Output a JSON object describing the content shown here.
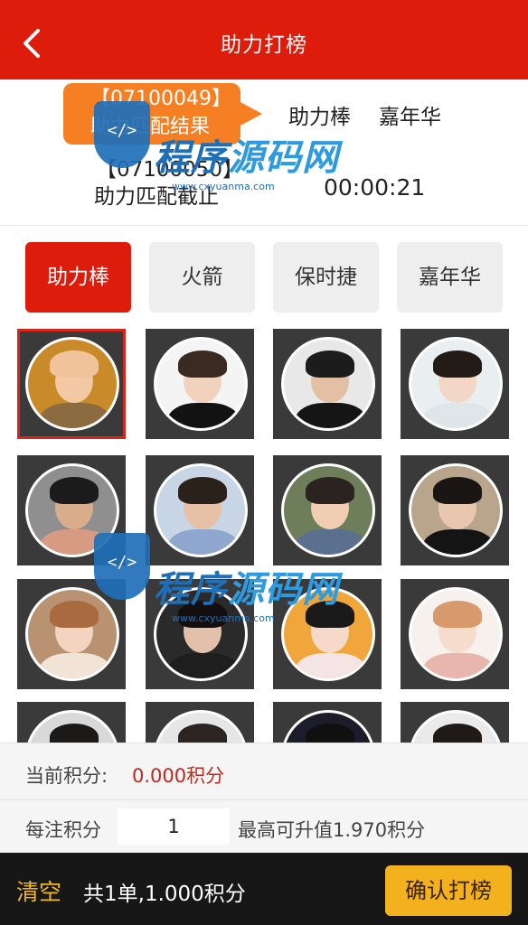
{
  "header": {
    "title": "助力打榜",
    "back_icon": "chevron-left-icon"
  },
  "info": {
    "bubble_line1": "【07100049】",
    "bubble_line2": "助力匹配结果",
    "prize_a": "助力棒",
    "prize_b": "嘉年华",
    "deadline_id": "【07100050】",
    "deadline_label": "助力匹配截止",
    "countdown": "00:00:21"
  },
  "tabs": [
    {
      "label": "助力棒",
      "active": true
    },
    {
      "label": "火箭",
      "active": false
    },
    {
      "label": "保时捷",
      "active": false
    },
    {
      "label": "嘉年华",
      "active": false
    }
  ],
  "avatars": [
    {
      "bg": "#c98a2a",
      "skin": "#f3c9a4",
      "hair": "#f1c39b",
      "cloth": "#8b6b3f",
      "selected": true
    },
    {
      "bg": "#f4f4f4",
      "skin": "#f1d2bd",
      "hair": "#3a2a22",
      "cloth": "#121212",
      "selected": false
    },
    {
      "bg": "#e8e8e8",
      "skin": "#e3bfa4",
      "hair": "#1c1c1c",
      "cloth": "#151515",
      "selected": false
    },
    {
      "bg": "#e9eef1",
      "skin": "#f2d7c6",
      "hair": "#231b16",
      "cloth": "#dfe6ea",
      "selected": false
    },
    {
      "bg": "#8f8f8f",
      "skin": "#d7ad8c",
      "hair": "#1b1b1b",
      "cloth": "#d79a83",
      "selected": false
    },
    {
      "bg": "#c7d5e4",
      "skin": "#e6c1a5",
      "hair": "#2a211b",
      "cloth": "#8fa7cf",
      "selected": false
    },
    {
      "bg": "#6f7e5a",
      "skin": "#f0cdb3",
      "hair": "#2a2320",
      "cloth": "#5b6f8f",
      "selected": false
    },
    {
      "bg": "#b8a58c",
      "skin": "#e9c7ae",
      "hair": "#1a1614",
      "cloth": "#141414",
      "selected": false
    },
    {
      "bg": "#b99271",
      "skin": "#f3d4c0",
      "hair": "#a86a3e",
      "cloth": "#f1e3d5",
      "selected": false
    },
    {
      "bg": "#2a2a2a",
      "skin": "#e2c0a9",
      "hair": "#120f0e",
      "cloth": "#1e1e1e",
      "selected": false
    },
    {
      "bg": "#f0a63b",
      "skin": "#f6d9c9",
      "hair": "#1a1a1a",
      "cloth": "#f4e4e4",
      "selected": false
    },
    {
      "bg": "#f7f1ee",
      "skin": "#f5dccd",
      "hair": "#d89a6b",
      "cloth": "#e9b6ad",
      "selected": false
    },
    {
      "bg": "#d9d9d9",
      "skin": "#e5c2a8",
      "hair": "#1c1a19",
      "cloth": "#333333",
      "selected": false
    },
    {
      "bg": "#e6e6e6",
      "skin": "#f0d1bd",
      "hair": "#2b2420",
      "cloth": "#444444",
      "selected": false
    },
    {
      "bg": "#1c1c2a",
      "skin": "#dcb89f",
      "hair": "#101010",
      "cloth": "#222222",
      "selected": false
    },
    {
      "bg": "#eaeaea",
      "skin": "#ecc9b2",
      "hair": "#201a17",
      "cloth": "#555555",
      "selected": false
    }
  ],
  "watermark": {
    "text_a": "程序",
    "text_b": "源码网",
    "url": "www.cxyuanma.com"
  },
  "score": {
    "current_label": "当前积分:",
    "current_value": "0.000积分",
    "bet_label": "每注积分",
    "bet_value": "1",
    "max_label": "最高可升值1.970积分"
  },
  "footer": {
    "clear_label": "清空",
    "summary": "共1单,1.000积分",
    "confirm_label": "确认打榜"
  },
  "colors": {
    "brand_red": "#dd1c0c",
    "bubble_orange": "#f57f22",
    "confirm_gold": "#f3b11d",
    "score_red": "#c0281d"
  }
}
